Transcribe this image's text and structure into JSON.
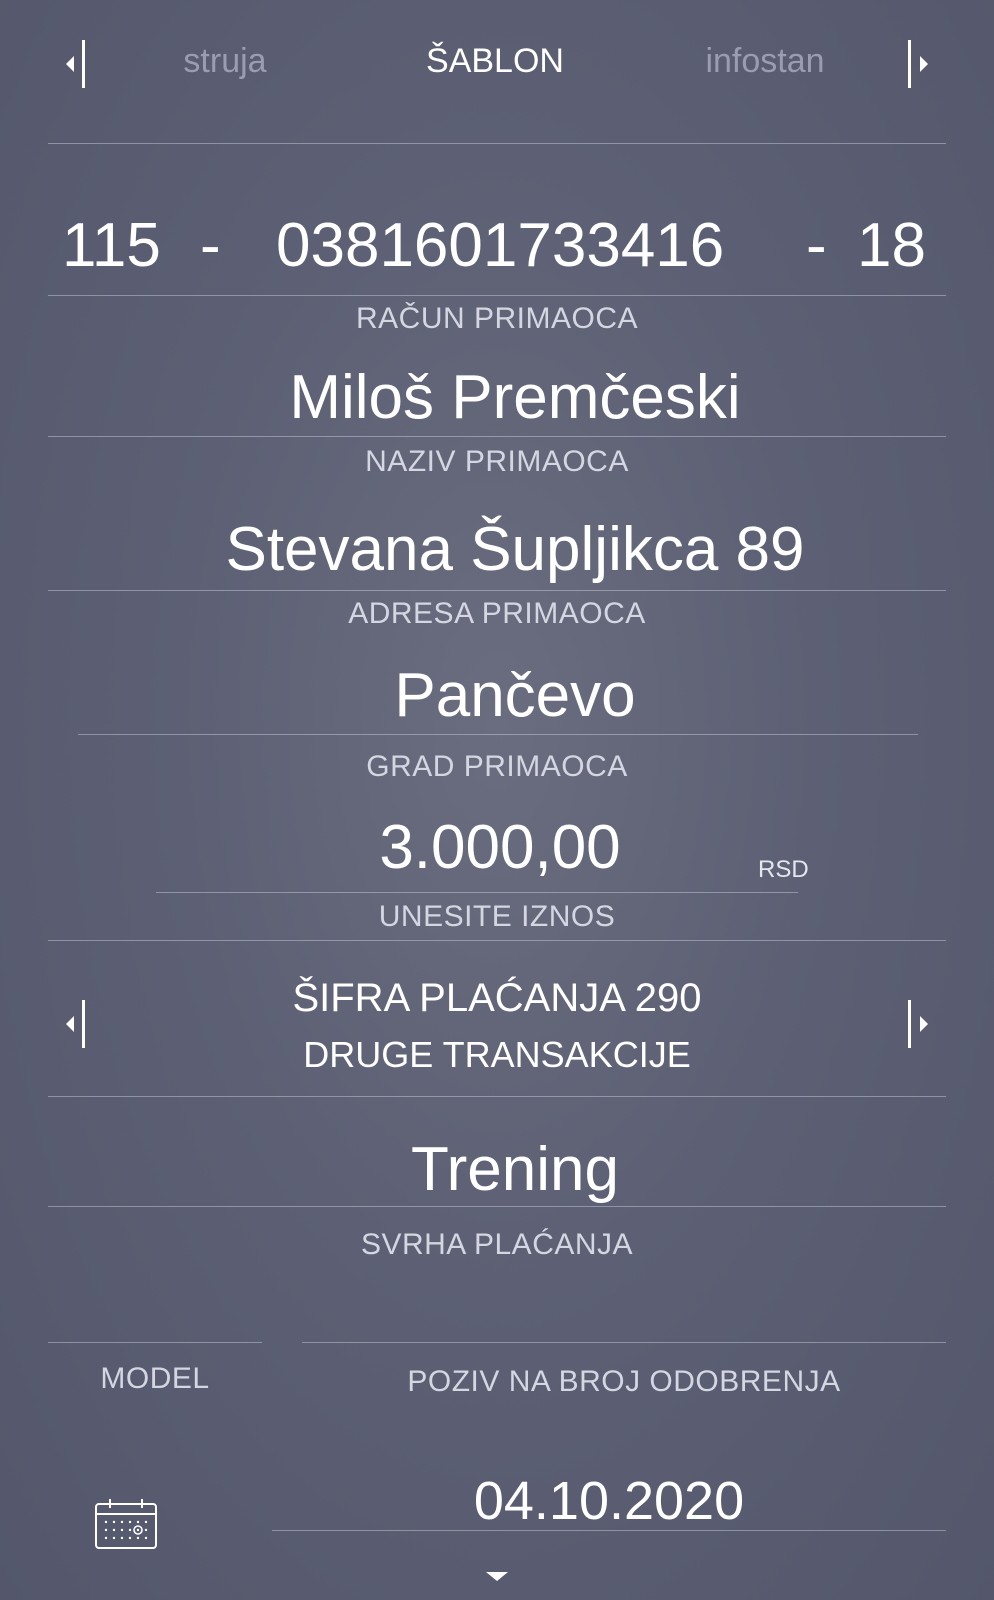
{
  "tabs": {
    "prev": "struja",
    "active": "ŠABLON",
    "next": "infostan"
  },
  "account": {
    "bank": "115",
    "sep1": "-",
    "number": "0381601733416",
    "sep2": "-",
    "control": "18",
    "label": "RAČUN PRIMAOCA"
  },
  "recipient_name": {
    "value": "Miloš Premčeski",
    "label": "NAZIV PRIMAOCA"
  },
  "recipient_address": {
    "value": "Stevana Šupljikca 89",
    "label": "ADRESA PRIMAOCA"
  },
  "recipient_city": {
    "value": "Pančevo",
    "label": "GRAD PRIMAOCA"
  },
  "amount": {
    "value": "3.000,00",
    "currency": "RSD",
    "label": "UNESITE IZNOS"
  },
  "payment_code": {
    "title": "ŠIFRA PLAĆANJA 290",
    "description": "DRUGE TRANSAKCIJE"
  },
  "purpose": {
    "value": "Trening",
    "label": "SVRHA PLAĆANJA"
  },
  "model": {
    "value": "",
    "label": "MODEL"
  },
  "reference": {
    "value": "",
    "label": "POZIV NA BROJ ODOBRENJA"
  },
  "date": {
    "value": "04.10.2020"
  },
  "icons": {
    "tab_prev": "chevron-left-icon",
    "tab_next": "chevron-right-icon",
    "code_prev": "chevron-left-icon",
    "code_next": "chevron-right-icon",
    "calendar": "calendar-icon",
    "expand": "chevron-down-icon"
  },
  "colors": {
    "background": "#5d6074",
    "text": "#ffffff",
    "inactive_tab": "#9a9db0"
  }
}
